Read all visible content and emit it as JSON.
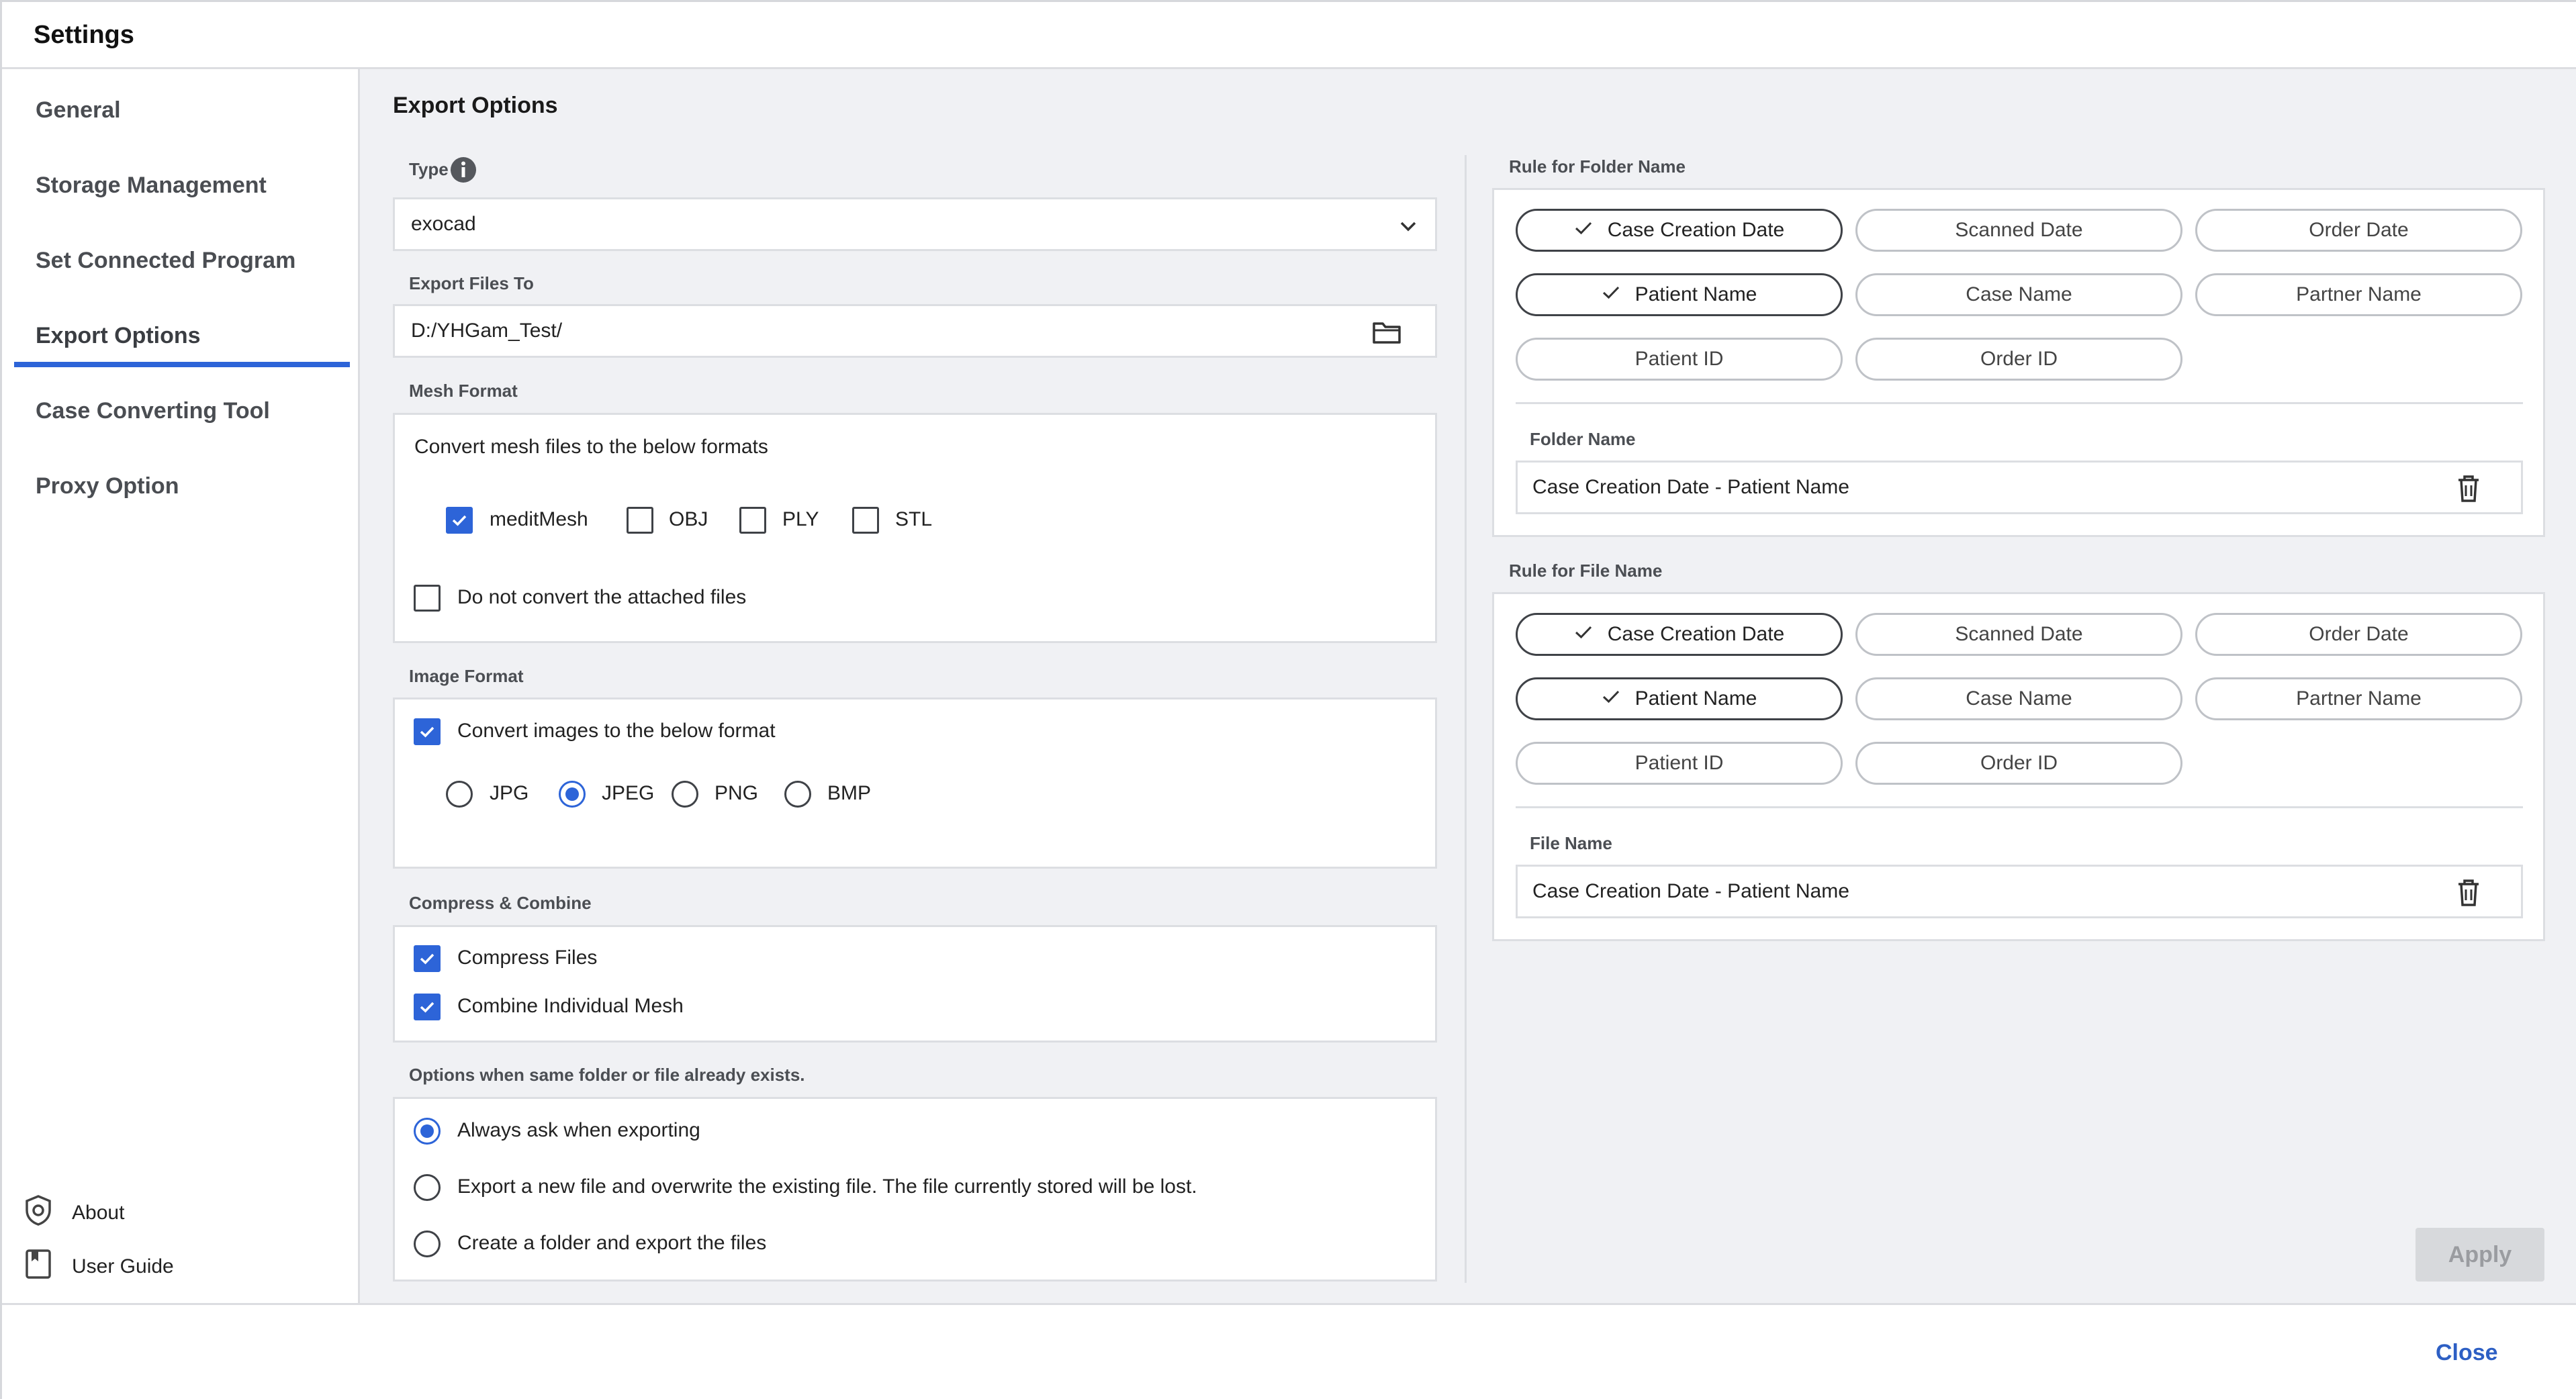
{
  "window": {
    "title": "Settings"
  },
  "sidebar": {
    "items": [
      {
        "label": "General"
      },
      {
        "label": "Storage Management"
      },
      {
        "label": "Set Connected Program"
      },
      {
        "label": "Export Options",
        "active": true
      },
      {
        "label": "Case Converting Tool"
      },
      {
        "label": "Proxy Option"
      }
    ],
    "links": [
      {
        "label": "About",
        "icon": "shield-icon"
      },
      {
        "label": "User Guide",
        "icon": "book-icon"
      }
    ]
  },
  "export": {
    "title": "Export Options",
    "type": {
      "label": "Type",
      "value": "exocad",
      "info_icon": "info-icon"
    },
    "export_to": {
      "label": "Export Files To",
      "value": "D:/YHGam_Test/",
      "icon": "folder-icon"
    },
    "mesh": {
      "label": "Mesh Format",
      "description": "Convert mesh files to the below formats",
      "formats": [
        {
          "label": "meditMesh",
          "checked": true
        },
        {
          "label": "OBJ",
          "checked": false
        },
        {
          "label": "PLY",
          "checked": false
        },
        {
          "label": "STL",
          "checked": false
        }
      ],
      "no_convert": {
        "label": "Do not convert the attached files",
        "checked": false
      }
    },
    "image": {
      "label": "Image Format",
      "convert": {
        "label": "Convert images to the below format",
        "checked": true
      },
      "formats": [
        {
          "label": "JPG",
          "selected": false
        },
        {
          "label": "JPEG",
          "selected": true
        },
        {
          "label": "PNG",
          "selected": false
        },
        {
          "label": "BMP",
          "selected": false
        }
      ]
    },
    "compress": {
      "label": "Compress & Combine",
      "options": [
        {
          "label": "Compress Files",
          "checked": true
        },
        {
          "label": "Combine Individual Mesh",
          "checked": true
        }
      ]
    },
    "exists": {
      "label": "Options when same folder or file already exists.",
      "options": [
        {
          "label": "Always ask when exporting",
          "selected": true
        },
        {
          "label": "Export a new file and overwrite the existing file. The file currently stored will be lost.",
          "selected": false
        },
        {
          "label": "Create a folder and export the files",
          "selected": false
        }
      ]
    }
  },
  "folder_rule": {
    "label": "Rule for Folder Name",
    "chips": [
      {
        "label": "Case Creation Date",
        "on": true
      },
      {
        "label": "Scanned Date",
        "on": false
      },
      {
        "label": "Order Date",
        "on": false
      },
      {
        "label": "Patient Name",
        "on": true
      },
      {
        "label": "Case Name",
        "on": false
      },
      {
        "label": "Partner Name",
        "on": false
      },
      {
        "label": "Patient ID",
        "on": false
      },
      {
        "label": "Order ID",
        "on": false
      }
    ],
    "name_label": "Folder Name",
    "name_value": "Case Creation Date - Patient Name"
  },
  "file_rule": {
    "label": "Rule for File Name",
    "chips": [
      {
        "label": "Case Creation Date",
        "on": true
      },
      {
        "label": "Scanned Date",
        "on": false
      },
      {
        "label": "Order Date",
        "on": false
      },
      {
        "label": "Patient Name",
        "on": true
      },
      {
        "label": "Case Name",
        "on": false
      },
      {
        "label": "Partner Name",
        "on": false
      },
      {
        "label": "Patient ID",
        "on": false
      },
      {
        "label": "Order ID",
        "on": false
      }
    ],
    "name_label": "File Name",
    "name_value": "Case Creation Date - Patient Name"
  },
  "actions": {
    "apply": "Apply",
    "close": "Close"
  },
  "colors": {
    "accent": "#2d64d8",
    "close_text": "#2d5fc4",
    "panel_bg": "#f0f1f4"
  }
}
